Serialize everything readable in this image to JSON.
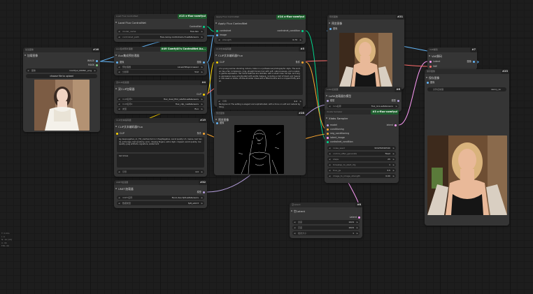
{
  "colors": {
    "image": "#64b5f6",
    "model": "#b39ddb",
    "clip": "#ffd500",
    "vae": "#ff6e6e",
    "conditioning": "#ffa931",
    "latent": "#ff9cf9",
    "controlnet": "#00d78d",
    "int": "#7ea7cf",
    "badge_green": "#1e5e2e",
    "node_bg": "#353535",
    "header_bg": "#2a2a2a"
  },
  "nodes": {
    "load_image": {
      "tag": "加载图像",
      "badge": "#16",
      "title": "加载图像",
      "out_label": "IMAGE",
      "out2": "MASK",
      "image_field": "图像",
      "image_value": "Comfyui_00082_.png",
      "upload_button": "choose file to upload"
    },
    "aux_preprocessor": {
      "tag": "Aux集成预处理器",
      "badge": "#49 ComfyUI's ControlNet Au...",
      "title": "Aux集成预处理器",
      "in_label": "图像",
      "out_label": "图像",
      "widgets": [
        {
          "k": "预处理器",
          "v": "LineArtPreprocessor"
        },
        {
          "k": "分辨率",
          "v": "512"
        }
      ]
    },
    "flux_controlnet_loader": {
      "tag": "Load Flux ControlNet",
      "badge": "#13 x-flux-comfyui",
      "title": "Load Flux ControlNet",
      "out_label": "ControlNet",
      "widgets": [
        {
          "k": "model_name",
          "v": "flux-dev"
        },
        {
          "k": "controlnet_path",
          "v": "flux-canny-controlnet-v3.safetensors"
        }
      ]
    },
    "dual_clip": {
      "tag": "双CLIP加载器",
      "badge": "#4",
      "title": "双CLIP加载器",
      "out_label": "CLIP",
      "widgets": [
        {
          "k": "CLIP名称1",
          "v": "flux_dual_t5xl_wte5b.safetensors"
        },
        {
          "k": "CLIP名称2",
          "v": "flux_clip_l.safetensors"
        },
        {
          "k": "类型",
          "v": "flux"
        }
      ]
    },
    "clip_encode_neg": {
      "tag": "CLIP文本编码器",
      "badge": "#19",
      "title": "CLIP文本编码器Flux",
      "in_label": "CLIP",
      "out_label": "条件",
      "text1": "bg,deepnegative_v1_75t_,badhandv4:1.2, EasyNegative, worst quality:1.5, lowres, bad hands, extra legs, bad anatomy, error, missing fingers, extra digit, cropped, worst quality, low quality, jpeg artifacts, signature, watermark",
      "text2": "bad shoes",
      "guidance_k": "引导",
      "guidance_v": "4.0"
    },
    "unet": {
      "tag": "UNET加载器",
      "badge": "#32",
      "title": "UNET加载器",
      "out_label": "模型",
      "widgets": [
        {
          "k": "UNET名称",
          "v": "flux1-dev-fp8.safetensors"
        },
        {
          "k": "数据类型",
          "v": "fp8_e4m3"
        }
      ]
    },
    "apply_flux_controlnet": {
      "tag": "Apply Flux ControlNet",
      "badge": "#14 x-flux-comfyui",
      "title": "Apply Flux ControlNet",
      "in1": "controlnet",
      "in2": "image",
      "out_label": "controlnet_condition",
      "widgets": [
        {
          "k": "strength",
          "v": "0.70"
        }
      ]
    },
    "clip_encode_pos": {
      "tag": "CLIP文本编码器",
      "badge": "#5",
      "title": "CLIP文本编码器Flux",
      "in_label": "CLIP",
      "out_label": "条件",
      "text1": "of a young woman standing indoors, taken in a professional photographic style. The woman has a fair complexion, long, straight brown hair with soft, natural waves, and a relaxed, gentle expression. Her facial features are delicate, with a small nose, full lips, and large, expressive eyes accentuated with subtle makeup, including a hint of blush and mascara. She wears a white, off-the-shoulder dress with a fitted bodice and a cropped fluffy jacket.",
      "text2": "Background: The setting is elegant and sophisticated, with a focus on soft and natural lighting.",
      "guidance_k": "引导",
      "guidance_v": "4.0"
    },
    "preview_lineart": {
      "tag": "预览图像",
      "badge": "#28",
      "title": "预览图像",
      "in_label": "图像"
    },
    "preview_top": {
      "tag": "预览图像",
      "badge": "#21",
      "title": "预览图像",
      "in_label": "图像"
    },
    "lora_loader": {
      "tag": "LoRA加载器",
      "badge": "#6",
      "title": "LoRA加载器仅模型",
      "in_label": "模型",
      "out_label": "模型",
      "widgets": [
        {
          "k": "lora名称",
          "v": "flux_lora.safetensors"
        }
      ]
    },
    "xlabs_sampler": {
      "tag": "XLabs Sampler",
      "badge": "#3 x-flux-comfyui",
      "title": "Xlabs Sampler",
      "inputs": [
        "model",
        "conditioning",
        "neg_conditioning",
        "latent_image",
        "controlnet_condition"
      ],
      "out_label": "latent",
      "widgets": [
        {
          "k": "noise_seed",
          "v": "324250320540"
        },
        {
          "k": "control_after_generate",
          "v": "fixed"
        },
        {
          "k": "steps",
          "v": "25"
        },
        {
          "k": "timestep_to_start_cfg",
          "v": "1"
        },
        {
          "k": "true_gs",
          "v": "3.5"
        },
        {
          "k": "image_to_image_strength",
          "v": "0.00"
        }
      ]
    },
    "empty_latent": {
      "tag": "空Latent",
      "badge": "#8",
      "title": "空Latent",
      "out_label": "Latent",
      "widgets": [
        {
          "k": "宽度",
          "v": "1024"
        },
        {
          "k": "高度",
          "v": "1024"
        },
        {
          "k": "批次大小",
          "v": "1"
        }
      ]
    },
    "vae_decode": {
      "tag": "VAE解码",
      "badge": "#7",
      "title": "VAE解码",
      "in1": "Latent",
      "in2": "VAE",
      "out_label": "图像"
    },
    "save_image": {
      "tag": "保存图像",
      "badge": "#23",
      "title": "保存图像",
      "in_label": "图像",
      "widgets": [
        {
          "k": "文件名前缀",
          "v": "canny_xo"
        }
      ]
    }
  },
  "stats_panel": [
    "T: 0.00s",
    "I: 0",
    "N: 16 [16]",
    "V: 38",
    "FPS: 60"
  ]
}
